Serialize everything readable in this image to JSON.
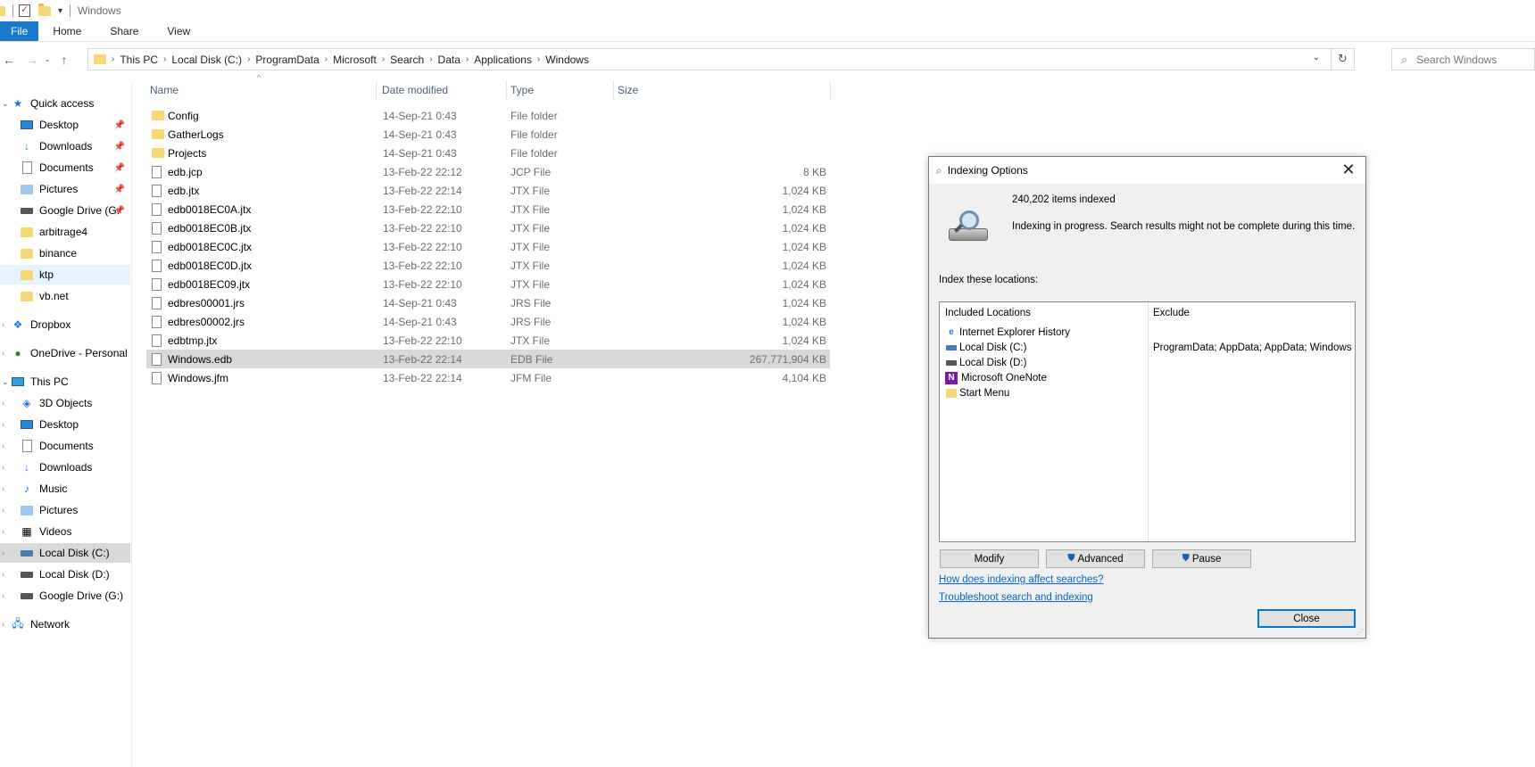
{
  "window": {
    "title": "Windows"
  },
  "ribbon": {
    "tabs": [
      "File",
      "Home",
      "Share",
      "View"
    ]
  },
  "address": {
    "crumbs": [
      "This PC",
      "Local Disk (C:)",
      "ProgramData",
      "Microsoft",
      "Search",
      "Data",
      "Applications",
      "Windows"
    ],
    "search_placeholder": "Search Windows"
  },
  "nav": {
    "items": [
      {
        "label": "Quick access",
        "icon": "star-icon"
      },
      {
        "label": "Desktop",
        "icon": "desktop-icon",
        "pinned": true
      },
      {
        "label": "Downloads",
        "icon": "download-icon",
        "pinned": true
      },
      {
        "label": "Documents",
        "icon": "documents-icon",
        "pinned": true
      },
      {
        "label": "Pictures",
        "icon": "pictures-icon",
        "pinned": true
      },
      {
        "label": "Google Drive (G:",
        "icon": "drive-icon",
        "pinned": true
      },
      {
        "label": "arbitrage4",
        "icon": "folder-icon"
      },
      {
        "label": "binance",
        "icon": "folder-icon"
      },
      {
        "label": "ktp",
        "icon": "folder-icon"
      },
      {
        "label": "vb.net",
        "icon": "folder-icon"
      },
      {
        "label": "Dropbox",
        "icon": "dropbox-icon"
      },
      {
        "label": "OneDrive - Personal",
        "icon": "onedrive-icon"
      },
      {
        "label": "This PC",
        "icon": "pc-icon"
      },
      {
        "label": "3D Objects",
        "icon": "3d-objects-icon"
      },
      {
        "label": "Desktop",
        "icon": "desktop-icon"
      },
      {
        "label": "Documents",
        "icon": "documents-icon"
      },
      {
        "label": "Downloads",
        "icon": "download-icon"
      },
      {
        "label": "Music",
        "icon": "music-icon"
      },
      {
        "label": "Pictures",
        "icon": "pictures-icon"
      },
      {
        "label": "Videos",
        "icon": "videos-icon"
      },
      {
        "label": "Local Disk (C:)",
        "icon": "drive-icon"
      },
      {
        "label": "Local Disk (D:)",
        "icon": "drive-icon"
      },
      {
        "label": "Google Drive (G:)",
        "icon": "drive-icon"
      },
      {
        "label": "Network",
        "icon": "network-icon"
      }
    ]
  },
  "files": {
    "columns": [
      "Name",
      "Date modified",
      "Type",
      "Size"
    ],
    "rows": [
      {
        "name": "Config",
        "date": "14-Sep-21 0:43",
        "type": "File folder",
        "size": "",
        "kind": "folder"
      },
      {
        "name": "GatherLogs",
        "date": "14-Sep-21 0:43",
        "type": "File folder",
        "size": "",
        "kind": "folder"
      },
      {
        "name": "Projects",
        "date": "14-Sep-21 0:43",
        "type": "File folder",
        "size": "",
        "kind": "folder"
      },
      {
        "name": "edb.jcp",
        "date": "13-Feb-22 22:12",
        "type": "JCP File",
        "size": "8 KB",
        "kind": "file"
      },
      {
        "name": "edb.jtx",
        "date": "13-Feb-22 22:14",
        "type": "JTX File",
        "size": "1,024 KB",
        "kind": "file"
      },
      {
        "name": "edb0018EC0A.jtx",
        "date": "13-Feb-22 22:10",
        "type": "JTX File",
        "size": "1,024 KB",
        "kind": "file"
      },
      {
        "name": "edb0018EC0B.jtx",
        "date": "13-Feb-22 22:10",
        "type": "JTX File",
        "size": "1,024 KB",
        "kind": "file"
      },
      {
        "name": "edb0018EC0C.jtx",
        "date": "13-Feb-22 22:10",
        "type": "JTX File",
        "size": "1,024 KB",
        "kind": "file"
      },
      {
        "name": "edb0018EC0D.jtx",
        "date": "13-Feb-22 22:10",
        "type": "JTX File",
        "size": "1,024 KB",
        "kind": "file"
      },
      {
        "name": "edb0018EC09.jtx",
        "date": "13-Feb-22 22:10",
        "type": "JTX File",
        "size": "1,024 KB",
        "kind": "file"
      },
      {
        "name": "edbres00001.jrs",
        "date": "14-Sep-21 0:43",
        "type": "JRS File",
        "size": "1,024 KB",
        "kind": "file"
      },
      {
        "name": "edbres00002.jrs",
        "date": "14-Sep-21 0:43",
        "type": "JRS File",
        "size": "1,024 KB",
        "kind": "file"
      },
      {
        "name": "edbtmp.jtx",
        "date": "13-Feb-22 22:10",
        "type": "JTX File",
        "size": "1,024 KB",
        "kind": "file"
      },
      {
        "name": "Windows.edb",
        "date": "13-Feb-22 22:14",
        "type": "EDB File",
        "size": "267,771,904 KB",
        "kind": "file"
      },
      {
        "name": "Windows.jfm",
        "date": "13-Feb-22 22:14",
        "type": "JFM File",
        "size": "4,104 KB",
        "kind": "file"
      }
    ]
  },
  "dialog": {
    "title": "Indexing Options",
    "items_indexed": "240,202 items indexed",
    "status": "Indexing in progress. Search results might not be complete during this time.",
    "index_label": "Index these locations:",
    "included_header": "Included Locations",
    "exclude_header": "Exclude",
    "locations": [
      {
        "label": "Internet Explorer History",
        "exclude": ""
      },
      {
        "label": "Local Disk (C:)",
        "exclude": "ProgramData; AppData; AppData; Windows"
      },
      {
        "label": "Local Disk (D:)",
        "exclude": ""
      },
      {
        "label": "Microsoft OneNote",
        "exclude": ""
      },
      {
        "label": "Start Menu",
        "exclude": ""
      }
    ],
    "buttons": {
      "modify": "Modify",
      "advanced": "Advanced",
      "pause": "Pause",
      "close": "Close"
    },
    "links": [
      "How does indexing affect searches?",
      "Troubleshoot search and indexing"
    ]
  }
}
